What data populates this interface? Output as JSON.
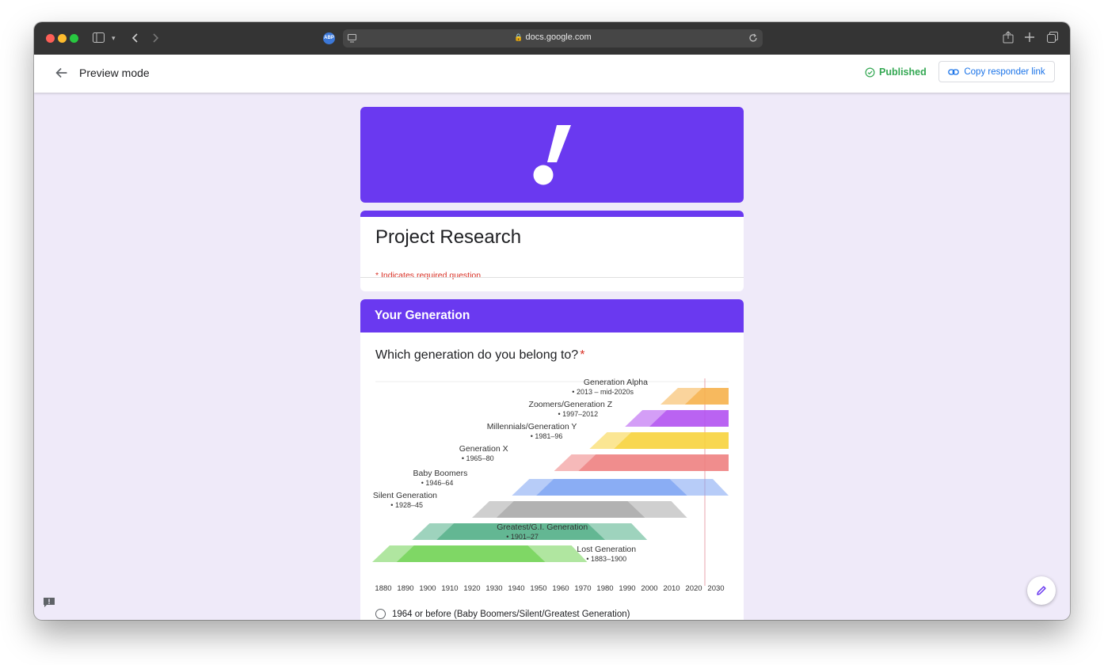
{
  "browser": {
    "url": "docs.google.com",
    "extension_badge": "ABP"
  },
  "topbar": {
    "preview_label": "Preview mode",
    "status": "Published",
    "copy_link_label": "Copy responder link"
  },
  "form": {
    "title": "Project Research",
    "required_note": "* Indicates required question",
    "section_title": "Your Generation",
    "question": "Which generation do you belong to?",
    "required_star": "*",
    "first_option": "1964 or before (Baby Boomers/Silent/Greatest Generation)"
  },
  "colors": {
    "brand": "#6a39f0",
    "published": "#34a853",
    "link": "#1a73e8",
    "required": "#d93025"
  },
  "chart_data": {
    "type": "timeline",
    "x_ticks": [
      "1880",
      "1890",
      "1900",
      "1910",
      "1920",
      "1930",
      "1940",
      "1950",
      "1960",
      "1970",
      "1980",
      "1990",
      "2000",
      "2010",
      "2020",
      "2030"
    ],
    "xlim": [
      1880,
      2030
    ],
    "marker_year": 2025,
    "series": [
      {
        "name": "Generation Alpha",
        "range_label": "• 2013 – mid-2020s",
        "birth_start": 2013,
        "birth_end": 2025,
        "color": "#f6b04a",
        "open_ended": true
      },
      {
        "name": "Zoomers/Generation Z",
        "range_label": "• 1997–2012",
        "birth_start": 1997,
        "birth_end": 2012,
        "color": "#b14ff0",
        "open_ended": true
      },
      {
        "name": "Millennials/Generation Y",
        "range_label": "• 1981–96",
        "birth_start": 1981,
        "birth_end": 1996,
        "color": "#f7d13a",
        "open_ended": true
      },
      {
        "name": "Generation X",
        "range_label": "• 1965–80",
        "birth_start": 1965,
        "birth_end": 1980,
        "color": "#ee7f7f",
        "open_ended": true
      },
      {
        "name": "Baby Boomers",
        "range_label": "• 1946–64",
        "birth_start": 1946,
        "birth_end": 1964,
        "color": "#7ba3f3",
        "open_ended": false
      },
      {
        "name": "Silent Generation",
        "range_label": "• 1928–45",
        "birth_start": 1928,
        "birth_end": 1945,
        "color": "#a8a8a8",
        "open_ended": false
      },
      {
        "name": "Greatest/G.I. Generation",
        "range_label": "• 1901–27",
        "birth_start": 1901,
        "birth_end": 1927,
        "color": "#4fae86",
        "open_ended": false
      },
      {
        "name": "Lost Generation",
        "range_label": "• 1883–1900",
        "birth_start": 1883,
        "birth_end": 1900,
        "color": "#6fd152",
        "open_ended": false
      }
    ]
  }
}
